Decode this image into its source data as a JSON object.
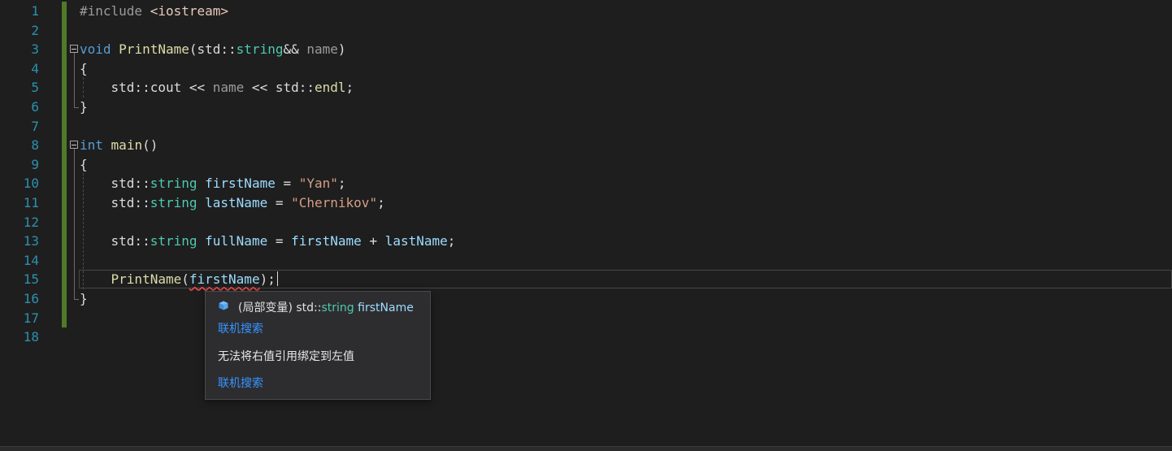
{
  "editor": {
    "line_numbers": [
      "1",
      "2",
      "3",
      "4",
      "5",
      "6",
      "7",
      "8",
      "9",
      "10",
      "11",
      "12",
      "13",
      "14",
      "15",
      "16",
      "17",
      "18"
    ],
    "lines": [
      [
        {
          "t": "#include ",
          "c": "pp"
        },
        {
          "t": "<iostream>",
          "c": "inc"
        }
      ],
      [],
      [
        {
          "t": "void",
          "c": "kw"
        },
        {
          "t": " "
        },
        {
          "t": "PrintName",
          "c": "fn"
        },
        {
          "t": "(std::"
        },
        {
          "t": "string",
          "c": "ty"
        },
        {
          "t": "&& "
        },
        {
          "t": "name",
          "c": "pa"
        },
        {
          "t": ")"
        }
      ],
      [
        {
          "t": "{"
        }
      ],
      [
        {
          "t": "    std::cout << "
        },
        {
          "t": "name",
          "c": "pa"
        },
        {
          "t": " << std::"
        },
        {
          "t": "endl",
          "c": "fn"
        },
        {
          "t": ";"
        }
      ],
      [
        {
          "t": "}"
        }
      ],
      [],
      [
        {
          "t": "int",
          "c": "kw"
        },
        {
          "t": " "
        },
        {
          "t": "main",
          "c": "fn"
        },
        {
          "t": "()"
        }
      ],
      [
        {
          "t": "{"
        }
      ],
      [
        {
          "t": "    std::"
        },
        {
          "t": "string",
          "c": "ty"
        },
        {
          "t": " "
        },
        {
          "t": "firstName",
          "c": "va"
        },
        {
          "t": " = "
        },
        {
          "t": "\"Yan\"",
          "c": "st"
        },
        {
          "t": ";"
        }
      ],
      [
        {
          "t": "    std::"
        },
        {
          "t": "string",
          "c": "ty"
        },
        {
          "t": " "
        },
        {
          "t": "lastName",
          "c": "va"
        },
        {
          "t": " = "
        },
        {
          "t": "\"Chernikov\"",
          "c": "st"
        },
        {
          "t": ";"
        }
      ],
      [],
      [
        {
          "t": "    std::"
        },
        {
          "t": "string",
          "c": "ty"
        },
        {
          "t": " "
        },
        {
          "t": "fullName",
          "c": "va"
        },
        {
          "t": " = "
        },
        {
          "t": "firstName",
          "c": "va"
        },
        {
          "t": " + "
        },
        {
          "t": "lastName",
          "c": "va"
        },
        {
          "t": ";"
        }
      ],
      [],
      [
        {
          "t": "    "
        },
        {
          "t": "PrintName",
          "c": "fn"
        },
        {
          "t": "("
        },
        {
          "t": "firstName",
          "c": "va",
          "squiggle": true
        },
        {
          "t": ");"
        }
      ],
      [
        {
          "t": "}"
        }
      ],
      [],
      []
    ],
    "modified_lines": [
      1,
      2,
      3,
      4,
      5,
      6,
      7,
      8,
      9,
      10,
      11,
      12,
      13,
      14,
      15,
      16,
      17
    ],
    "current_line": 15,
    "fold_markers": [
      3,
      8
    ]
  },
  "tooltip": {
    "symbol_kind": "(局部变量)",
    "symbol_ns": "std::",
    "symbol_type": "string",
    "symbol_name": "firstName",
    "search_link_1": "联机搜索",
    "error_message": "无法将右值引用绑定到左值",
    "search_link_2": "联机搜索",
    "icon": "local-variable-cube-icon"
  },
  "colors": {
    "background": "#1e1e1e",
    "line_number": "#2b91af",
    "keyword": "#569cd6",
    "type": "#4ec9b0",
    "function": "#dcdcaa",
    "string": "#d69d85",
    "variable": "#9cdcfe",
    "change_bar": "#4f7a28",
    "link": "#3794ff"
  }
}
